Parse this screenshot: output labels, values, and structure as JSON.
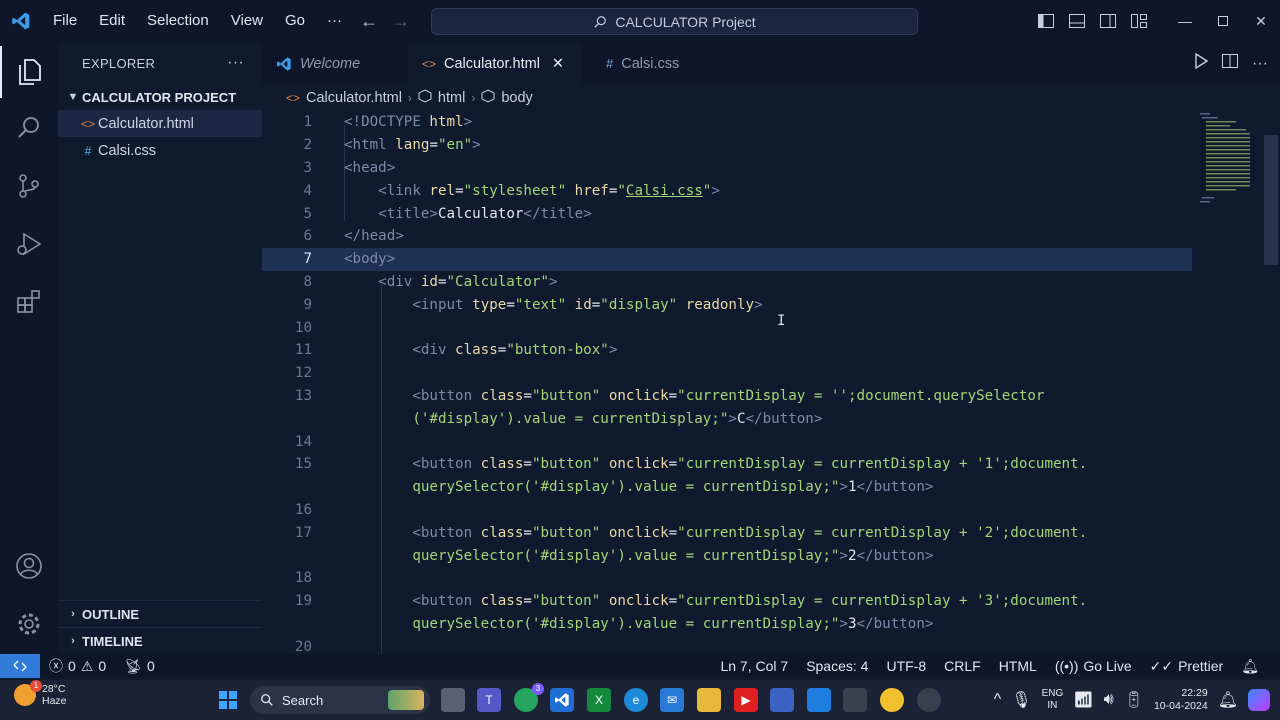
{
  "titlebar": {
    "menus": [
      "File",
      "Edit",
      "Selection",
      "View",
      "Go"
    ],
    "more": "···",
    "search_text": "CALCULATOR Project"
  },
  "sidebar": {
    "title": "EXPLORER",
    "more": "···",
    "project": "CALCULATOR PROJECT",
    "files": [
      {
        "name": "Calculator.html",
        "icon": "<>",
        "color": "#e8804a"
      },
      {
        "name": "Calsi.css",
        "icon": "#",
        "color": "#6fa8dc"
      }
    ],
    "outline": "OUTLINE",
    "timeline": "TIMELINE"
  },
  "tabs": [
    {
      "label": "Welcome"
    },
    {
      "label": "Calculator.html",
      "close": "✕"
    },
    {
      "label": "Calsi.css"
    }
  ],
  "breadcrumb": [
    "Calculator.html",
    "html",
    "body"
  ],
  "code": {
    "lines": [
      {
        "n": "1"
      },
      {
        "n": "2"
      },
      {
        "n": "3"
      },
      {
        "n": "4"
      },
      {
        "n": "5"
      },
      {
        "n": "6"
      },
      {
        "n": "7"
      },
      {
        "n": "8"
      },
      {
        "n": "9"
      },
      {
        "n": "10"
      },
      {
        "n": "11"
      },
      {
        "n": "12"
      },
      {
        "n": "13"
      },
      {
        "n": "14"
      },
      {
        "n": "15"
      },
      {
        "n": "16"
      },
      {
        "n": "17"
      },
      {
        "n": "18"
      },
      {
        "n": "19"
      },
      {
        "n": "20"
      }
    ],
    "text": {
      "l1_a": "<!",
      "l1_b": "DOCTYPE",
      "l1_c": " html",
      "l1_d": ">",
      "l2": [
        "<",
        "html",
        " lang",
        "=",
        "\"en\"",
        ">"
      ],
      "l3": [
        "<",
        "head",
        ">"
      ],
      "l4": [
        "<",
        "link",
        " rel",
        "=",
        "\"stylesheet\"",
        " href",
        "=",
        "\"",
        "Calsi.css",
        "\"",
        ">"
      ],
      "l5": [
        "<",
        "title",
        ">",
        "Calculator",
        "</",
        "title",
        ">"
      ],
      "l6": [
        "</",
        "head",
        ">"
      ],
      "l7": [
        "<",
        "body",
        ">"
      ],
      "l8": [
        "<",
        "div",
        " id",
        "=",
        "\"Calculator\"",
        ">"
      ],
      "l9": [
        "<",
        "input",
        " type",
        "=",
        "\"text\"",
        " id",
        "=",
        "\"display\"",
        " readonly",
        ">"
      ],
      "l11": [
        "<",
        "div",
        " class",
        "=",
        "\"button-box\"",
        ">"
      ],
      "l13a": [
        "<",
        "button",
        " class",
        "=",
        "\"button\"",
        " onclick",
        "=",
        "\"currentDisplay = '';document.querySelector"
      ],
      "l13b": [
        "('#display').value = currentDisplay;\"",
        ">",
        "C",
        "</",
        "button",
        ">"
      ],
      "l15a": [
        "<",
        "button",
        " class",
        "=",
        "\"button\"",
        " onclick",
        "=",
        "\"currentDisplay = currentDisplay + '1';document."
      ],
      "l15b": [
        "querySelector('#display').value = currentDisplay;\"",
        ">",
        "1",
        "</",
        "button",
        ">"
      ],
      "l17a": [
        "<",
        "button",
        " class",
        "=",
        "\"button\"",
        " onclick",
        "=",
        "\"currentDisplay = currentDisplay + '2';document."
      ],
      "l17b": [
        "querySelector('#display').value = currentDisplay;\"",
        ">",
        "2",
        "</",
        "button",
        ">"
      ],
      "l19a": [
        "<",
        "button",
        " class",
        "=",
        "\"button\"",
        " onclick",
        "=",
        "\"currentDisplay = currentDisplay + '3';document."
      ],
      "l19b": [
        "querySelector('#display').value = currentDisplay;\"",
        ">",
        "3",
        "</",
        "button",
        ">"
      ]
    }
  },
  "status": {
    "errors": "0",
    "warnings": "0",
    "ports": "0",
    "position": "Ln 7, Col 7",
    "spaces": "Spaces: 4",
    "encoding": "UTF-8",
    "eol": "CRLF",
    "language": "HTML",
    "golive": "Go Live",
    "prettier": "Prettier"
  },
  "taskbar": {
    "temp": "28°C",
    "weather": "Haze",
    "search": "Search",
    "lang1": "ENG",
    "lang2": "IN",
    "time": "22:29",
    "date": "10-04-2024",
    "weather_badge": "1",
    "whatsapp_badge": "3"
  },
  "colors": {
    "accent": "#2f7bd7",
    "tag": "#7c8aa8",
    "attr": "#e9d8a6",
    "string": "#a5d477"
  }
}
